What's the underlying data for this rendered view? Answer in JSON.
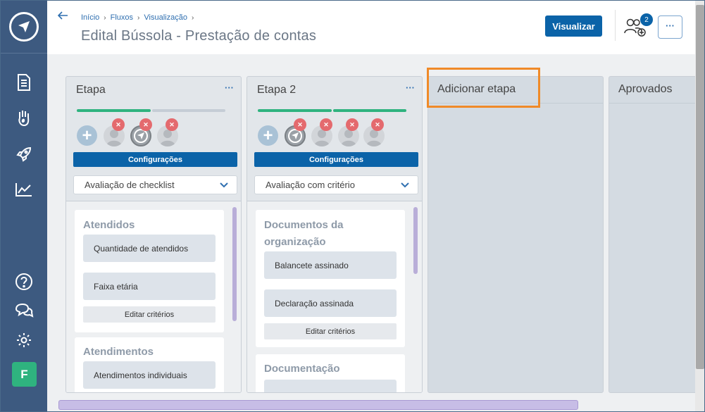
{
  "breadcrumb": {
    "items": [
      "Início",
      "Fluxos",
      "Visualização"
    ]
  },
  "header": {
    "title": "Edital Bússola - Prestação de contas",
    "visualizar_label": "Visualizar",
    "users_badge": "2",
    "more_label": "···"
  },
  "sidebar": {
    "items": [
      "logo-icon",
      "document-icon",
      "hand-heart-icon",
      "rocket-icon",
      "chart-icon",
      "help-icon",
      "chat-icon",
      "gear-icon"
    ],
    "avatar_letter": "F",
    "avatar_color": "#2fb37f"
  },
  "colors": {
    "primary": "#0b63a8",
    "success": "#2fb37f",
    "remove": "#e46a6e",
    "highlight": "#f08a28"
  },
  "columns": [
    {
      "title": "Etapa",
      "more_label": "···",
      "progress": [
        1,
        0
      ],
      "config_label": "Configurações",
      "select_value": "Avaliação de checklist",
      "cards": [
        {
          "title": "Atendidos",
          "criteria": [
            "Quantidade de atendidos",
            "Faixa etária"
          ],
          "edit_label": "Editar critérios"
        },
        {
          "title": "Atendimentos",
          "criteria": [
            "Atendimentos individuais"
          ]
        }
      ]
    },
    {
      "title": "Etapa 2",
      "more_label": "···",
      "progress": [
        1,
        1
      ],
      "config_label": "Configurações",
      "select_value": "Avaliação com critério",
      "cards": [
        {
          "title": "Documentos da organização",
          "criteria": [
            "Balancete assinado",
            "Declaração assinada"
          ],
          "edit_label": "Editar critérios"
        },
        {
          "title": "Documentação"
        }
      ]
    }
  ],
  "add_column": {
    "title": "Adicionar etapa"
  },
  "approved_column": {
    "title": "Aprovados"
  }
}
